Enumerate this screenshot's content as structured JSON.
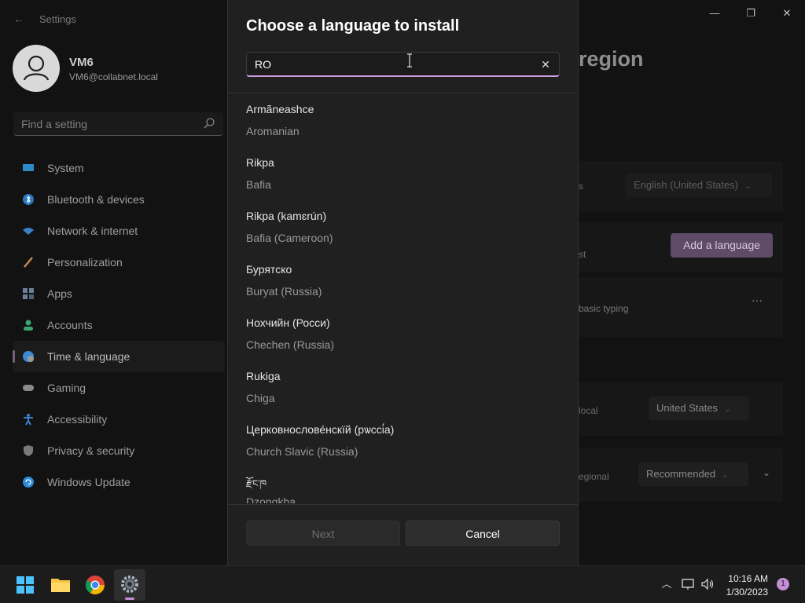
{
  "window": {
    "app_title": "Settings",
    "minimize": "—",
    "maximize": "❐",
    "close": "✕"
  },
  "profile": {
    "name": "VM6",
    "email": "VM6@collabnet.local"
  },
  "search": {
    "placeholder": "Find a setting"
  },
  "sidebar": {
    "items": [
      {
        "label": "System",
        "icon": "system-icon",
        "color": "#2e8bc9"
      },
      {
        "label": "Bluetooth & devices",
        "icon": "bluetooth-icon",
        "color": "#2b78c2"
      },
      {
        "label": "Network & internet",
        "icon": "wifi-icon",
        "color": "#3d7fc3"
      },
      {
        "label": "Personalization",
        "icon": "brush-icon",
        "color": "#c48a4e"
      },
      {
        "label": "Apps",
        "icon": "apps-icon",
        "color": "#6b7f98"
      },
      {
        "label": "Accounts",
        "icon": "accounts-icon",
        "color": "#3aa570"
      },
      {
        "label": "Time & language",
        "icon": "globe-clock-icon",
        "color": "#3b8ad3"
      },
      {
        "label": "Gaming",
        "icon": "gamepad-icon",
        "color": "#8a8a8a"
      },
      {
        "label": "Accessibility",
        "icon": "accessibility-icon",
        "color": "#3a7fd0"
      },
      {
        "label": "Privacy & security",
        "icon": "shield-icon",
        "color": "#7a7a7a"
      },
      {
        "label": "Windows Update",
        "icon": "update-icon",
        "color": "#2e8bd9"
      }
    ],
    "active_index": 6
  },
  "background_page": {
    "title": "region",
    "display_language_label": "s",
    "display_language_value": "English (United States)",
    "add_language_label": "Add a language",
    "preferred_label": "st",
    "english_detail": "basic typing",
    "more_button": "···",
    "country_label": "local",
    "country_value": "United States",
    "format_label": "egional",
    "format_value": "Recommended"
  },
  "dialog": {
    "title": "Choose a language to install",
    "search_value": "RO",
    "clear_icon": "✕",
    "languages": [
      {
        "native": "Armãneashce",
        "english": "Aromanian"
      },
      {
        "native": "Rikpa",
        "english": "Bafia"
      },
      {
        "native": "Rikpa (kamɛrún)",
        "english": "Bafia (Cameroon)"
      },
      {
        "native": "Бурятско",
        "english": "Buryat (Russia)"
      },
      {
        "native": "Нохчийн (Росси)",
        "english": "Chechen (Russia)"
      },
      {
        "native": "Rukiga",
        "english": "Chiga"
      },
      {
        "native": "Церковнослове́нскїй (рѡссі́а)",
        "english": "Church Slavic (Russia)"
      },
      {
        "native": "རྫོང་ཁ",
        "english": "Dzongkha"
      }
    ],
    "next_label": "Next",
    "cancel_label": "Cancel"
  },
  "taskbar": {
    "time": "10:16 AM",
    "date": "1/30/2023",
    "notification_count": "1",
    "accent": "#c58fd6"
  }
}
